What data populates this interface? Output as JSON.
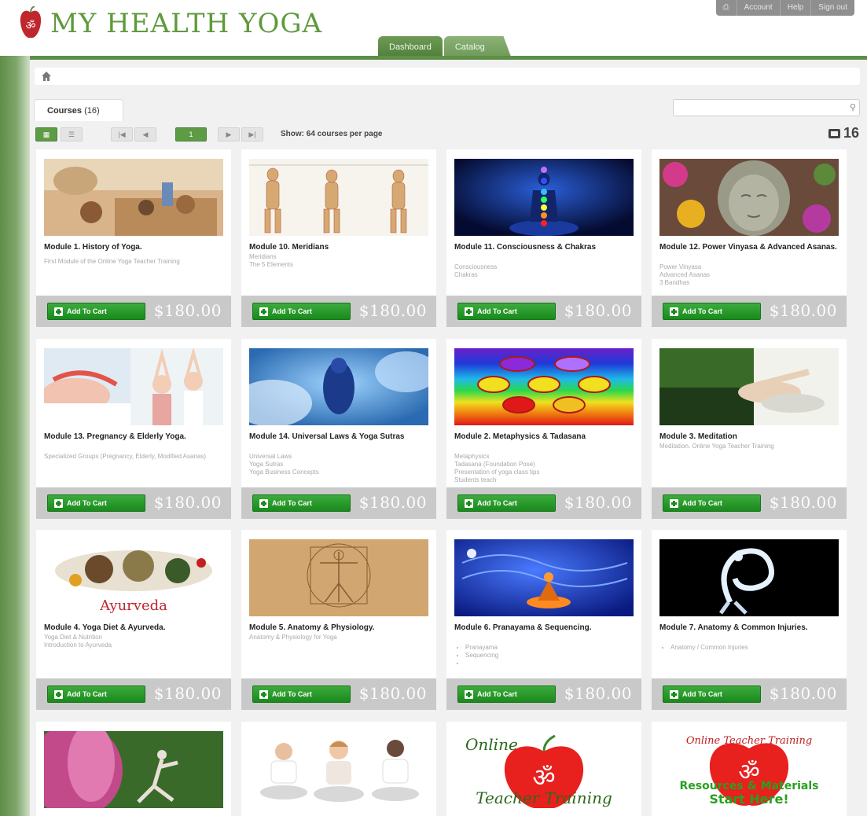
{
  "header": {
    "logo_text": "MY HEALTH YOGA",
    "top_nav": [
      "Account",
      "Help",
      "Sign out"
    ],
    "tabs": [
      "Dashboard",
      "Catalog"
    ]
  },
  "catalog": {
    "courses_tab_label": "Courses",
    "courses_tab_count": "(16)",
    "search_placeholder": "",
    "page_number": "1",
    "show_label": "Show: 64 courses per page",
    "total_count": "16"
  },
  "colors": {
    "brand_green": "#5e8e47",
    "button_green": "#198a1c",
    "price_bar": "#c9c9c9"
  },
  "courses": [
    {
      "title": "Module 1. History of Yoga.",
      "desc": [
        "First Module of the Online Yoga Teacher Training"
      ],
      "add_label": "Add To Cart",
      "price": "$180.00"
    },
    {
      "title": "Module 10. Meridians",
      "desc": [
        "Meridians",
        "The 5 Elements"
      ],
      "add_label": "Add To Cart",
      "price": "$180.00"
    },
    {
      "title": "Module 11. Consciousness & Chakras",
      "desc": [
        "Consciousness",
        "Chakras"
      ],
      "add_label": "Add To Cart",
      "price": "$180.00"
    },
    {
      "title": "Module 12. Power Vinyasa & Advanced Asanas.",
      "desc": [
        "Power Vinyasa",
        "Advanced Asanas",
        "3 Bandhas"
      ],
      "add_label": "Add To Cart",
      "price": "$180.00"
    },
    {
      "title": "Module 13. Pregnancy & Elderly Yoga.",
      "desc": [
        "Specialized Groups (Pregnancy, Elderly, Modified Asanas)"
      ],
      "add_label": "Add To Cart",
      "price": "$180.00"
    },
    {
      "title": "Module 14. Universal Laws & Yoga Sutras",
      "desc": [
        "Universal Laws",
        "Yoga Sutras",
        "Yoga Business Concepts"
      ],
      "add_label": "Add To Cart",
      "price": "$180.00"
    },
    {
      "title": "Module 2. Metaphysics & Tadasana",
      "desc": [
        "Metaphysics",
        "Tadasana (Foundation Pose)",
        "Presentation of yoga class tips",
        "Students teach"
      ],
      "add_label": "Add To Cart",
      "price": "$180.00"
    },
    {
      "title": "Module 3. Meditation",
      "desc": [
        "Meditation. Online Yoga Teacher Training"
      ],
      "add_label": "Add To Cart",
      "price": "$180.00"
    },
    {
      "title": "Module 4. Yoga Diet & Ayurveda.",
      "desc": [
        "Yoga Diet & Nutrition",
        "Introduction to Ayurveda"
      ],
      "add_label": "Add To Cart",
      "price": "$180.00",
      "image_caption": "Ayurveda"
    },
    {
      "title": "Module 5. Anatomy & Physiology.",
      "desc": [
        "Anatomy & Physiology for Yoga"
      ],
      "add_label": "Add To Cart",
      "price": "$180.00"
    },
    {
      "title": "Module 6. Pranayama & Sequencing.",
      "bullets": [
        "Pranayama",
        "Sequencing",
        ""
      ],
      "add_label": "Add To Cart",
      "price": "$180.00"
    },
    {
      "title": "Module 7. Anatomy & Common Injuries.",
      "bullets": [
        "Anatomy / Common Injuries"
      ],
      "add_label": "Add To Cart",
      "price": "$180.00"
    },
    {
      "title": "",
      "desc": []
    },
    {
      "title": "",
      "desc": []
    },
    {
      "title": "",
      "desc": [],
      "image_text": [
        "Online",
        "Teacher Training"
      ]
    },
    {
      "title": "",
      "desc": [],
      "image_text": [
        "Online Teacher Training",
        "Resources & Materials",
        "Start Here!"
      ]
    }
  ]
}
